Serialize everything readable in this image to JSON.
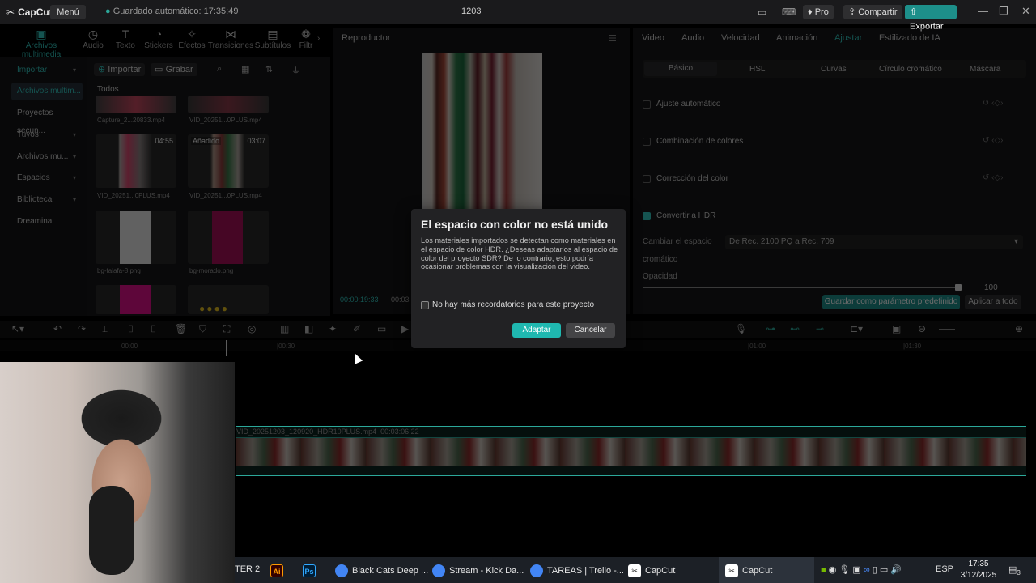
{
  "app": {
    "logo": "CapCut",
    "menu": "Menú",
    "autosave": "Guardado automático: 17:35:49",
    "project_title": "1203",
    "pro": "Pro",
    "share": "Compartir",
    "export": "Exportar"
  },
  "tool_tabs": [
    "Archivos multimedia",
    "Audio",
    "Texto",
    "Stickers",
    "Efectos",
    "Transiciones",
    "Subtítulos",
    "Filtr"
  ],
  "left_nav": {
    "import": "Importar",
    "items": [
      "Archivos multim...",
      "Proyectos secun...",
      "Tuyos",
      "Archivos mu...",
      "Espacios",
      "Biblioteca",
      "Dreamina"
    ]
  },
  "media": {
    "import_btn": "Importar",
    "record_btn": "Grabar",
    "all_label": "Todos",
    "items": [
      {
        "caption": "Capture_2...20833.mp4"
      },
      {
        "caption": "VID_20251...0PLUS.mp4"
      },
      {
        "caption": "VID_20251...0PLUS.mp4",
        "duration": "04:55"
      },
      {
        "caption": "VID_20251...0PLUS.mp4",
        "duration": "03:07",
        "tag": "Añadido"
      },
      {
        "caption": "bg-falafa-8.png"
      },
      {
        "caption": "bg-morado.png"
      }
    ]
  },
  "player": {
    "title": "Reproductor",
    "timecode": "00:00:19:33",
    "timecode2": "00:03"
  },
  "right_panel": {
    "tabs": [
      "Video",
      "Audio",
      "Velocidad",
      "Animación",
      "Ajustar",
      "Estilizado de IA"
    ],
    "subtabs": [
      "Básico",
      "HSL",
      "Curvas",
      "Círculo cromático",
      "Máscara"
    ],
    "adjustments": [
      "Ajuste automático",
      "Combinación de colores",
      "Corrección del color",
      "Convertir a HDR"
    ],
    "colorspace_label": "Cambiar el espacio",
    "colorspace_label2": "cromático",
    "colorspace_value": "De Rec. 2100 PQ a Rec. 709",
    "opacity_label": "Opacidad",
    "opacity_value": "100",
    "save_preset": "Guardar como parámetro predefinido",
    "apply_all": "Aplicar a todo"
  },
  "timeline": {
    "ticks": [
      "00:00",
      "|00:30",
      "|01:00",
      "|01:30"
    ],
    "clip_label": "VID_20251203_120920_HDR10PLUS.mp4",
    "clip_duration": "00:03:06:22"
  },
  "dialog": {
    "title": "El espacio con color no está unido",
    "body": "Los materiales importados se detectan como materiales en el espacio de color HDR. ¿Deseas adaptarlos al espacio de color del proyecto SDR? De lo contrario, esto podría ocasionar problemas con la visualización del video.",
    "checkbox": "No hay más recordatorios para este proyecto",
    "adapt": "Adaptar",
    "cancel": "Cancelar"
  },
  "taskbar": {
    "items": [
      "TER 2",
      "Black Cats Deep ...",
      "Stream - Kick Da...",
      "TAREAS | Trello -...",
      "CapCut",
      "CapCut"
    ],
    "lang": "ESP",
    "time": "17:35",
    "date": "3/12/2025",
    "notif": "3"
  }
}
